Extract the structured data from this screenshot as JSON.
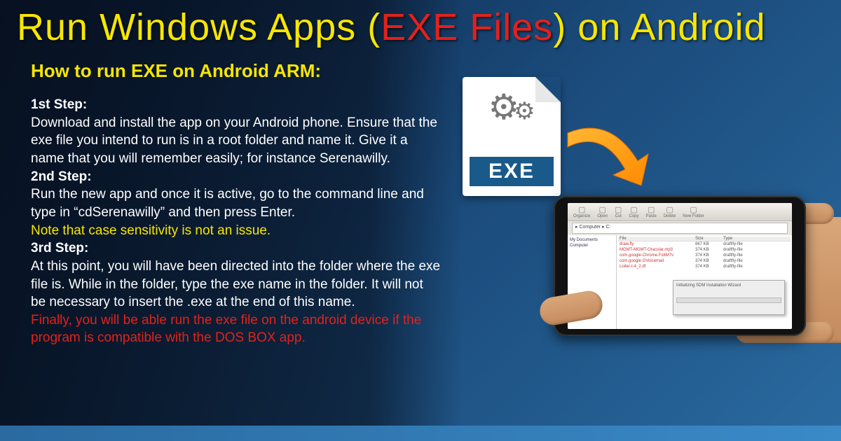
{
  "title": {
    "part1": "Run Windows Apps (",
    "part2": "EXE Files",
    "part3": ") on Android"
  },
  "subtitle": "How to run EXE on Android ARM:",
  "steps": {
    "s1_label": "1st Step:",
    "s1_body": "Download and install the app on your Android phone. Ensure that the exe file you intend to run is in a root folder and name it. Give it a name that you will remember easily; for instance Serenawilly.",
    "s2_label": "2nd Step:",
    "s2_body": "Run the new app and once it is active, go to the command line and type in “cdSerenawilly” and then press Enter.",
    "s2_note": "Note that case sensitivity is not an issue.",
    "s3_label": "3rd Step:",
    "s3_body": "At this point, you will have been directed into the folder where the exe file is. While in the folder, type the exe name in the folder. It will not be necessary to insert the .exe at the end of this name.",
    "s3_final": "Finally, you will be able run the exe file on the android device if the program is compatible with the DOS BOX app."
  },
  "exe_label": "EXE",
  "phone": {
    "toolbar": [
      "Organize",
      "Open",
      "Cut",
      "Copy",
      "Paste",
      "Delete",
      "New Folder"
    ],
    "addr": "▸ Computer ▸ C:",
    "tree": [
      "My Documents",
      "Computer"
    ],
    "headers": [
      "File",
      "Size",
      "Type"
    ],
    "rows": [
      [
        "draw.fly",
        "867 KB",
        "draftfly-file"
      ],
      [
        "MGMT-MGMT-Oracular.mp3",
        "374 KB",
        "draftfly-file"
      ],
      [
        "com.google.Chrome.Fx8M7v",
        "374 KB",
        "draftfly-file"
      ],
      [
        "com.google.GVoicemail",
        "374 KB",
        "draftfly-file"
      ],
      [
        "Loiter-t-4_2.df",
        "374 KB",
        "draftfly-file"
      ]
    ],
    "dialog": "Initializing SDM Installation Wizard"
  }
}
